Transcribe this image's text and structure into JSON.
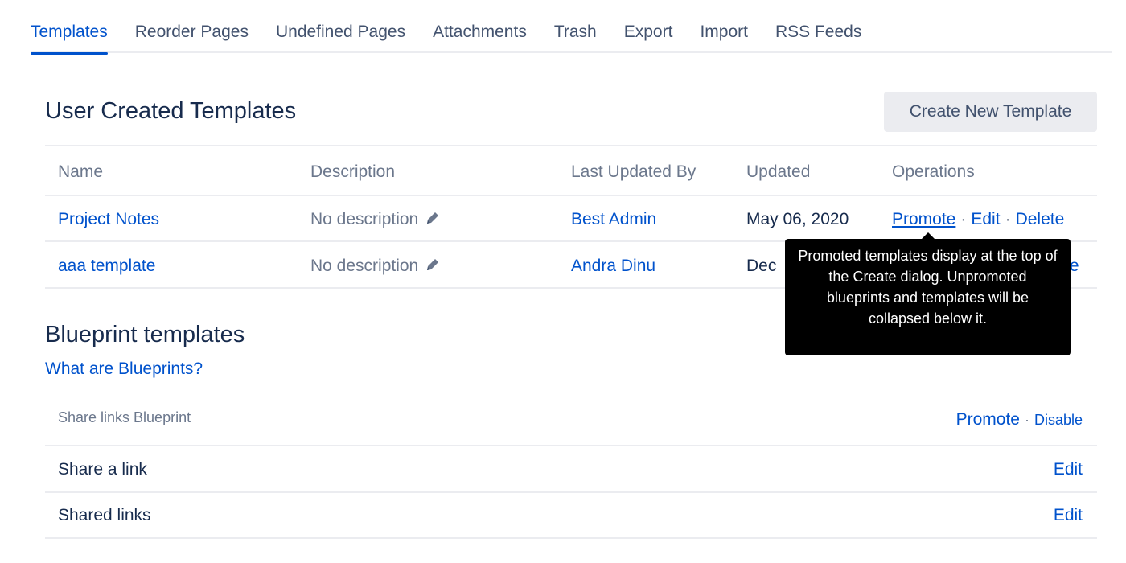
{
  "tabs": [
    {
      "label": "Templates",
      "active": true
    },
    {
      "label": "Reorder Pages",
      "active": false
    },
    {
      "label": "Undefined Pages",
      "active": false
    },
    {
      "label": "Attachments",
      "active": false
    },
    {
      "label": "Trash",
      "active": false
    },
    {
      "label": "Export",
      "active": false
    },
    {
      "label": "Import",
      "active": false
    },
    {
      "label": "RSS Feeds",
      "active": false
    }
  ],
  "user_templates": {
    "title": "User Created Templates",
    "create_button": "Create New Template",
    "columns": [
      "Name",
      "Description",
      "Last Updated By",
      "Updated",
      "Operations"
    ],
    "rows": [
      {
        "name": "Project Notes",
        "description": "No description",
        "updated_by": "Best Admin",
        "updated": "May 06, 2020",
        "ops": [
          "Promote",
          "Edit",
          "Delete"
        ]
      },
      {
        "name": "aaa template",
        "description": "No description",
        "updated_by": "Andra Dinu",
        "updated": "Dec",
        "ops_visible_tail": "te"
      }
    ],
    "separator": "·"
  },
  "tooltip": {
    "text": "Promoted templates display at the top of the Create dialog. Unpromoted blueprints and templates will be collapsed below it."
  },
  "blueprints": {
    "title": "Blueprint templates",
    "help_link": "What are Blueprints?",
    "group": {
      "name": "Share links Blueprint",
      "promote": "Promote",
      "disable": "Disable"
    },
    "items": [
      {
        "name": "Share a link",
        "op": "Edit"
      },
      {
        "name": "Shared links",
        "op": "Edit"
      }
    ]
  },
  "colors": {
    "link": "#0052cc",
    "heading": "#172b4d",
    "muted": "#6b778c",
    "border": "#ebecf0",
    "tooltip_bg": "#000000"
  }
}
